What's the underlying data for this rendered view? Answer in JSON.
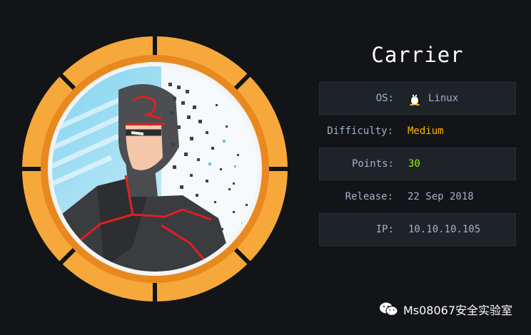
{
  "machine": {
    "name": "Carrier"
  },
  "info": {
    "os_label": "OS:",
    "os_value": "Linux",
    "os_icon": "linux-tux-icon",
    "difficulty_label": "Difficulty:",
    "difficulty_value": "Medium",
    "points_label": "Points:",
    "points_value": "30",
    "release_label": "Release:",
    "release_value": "22 Sep 2018",
    "ip_label": "IP:",
    "ip_value": "10.10.10.105"
  },
  "watermark": {
    "text": "Ms08067安全实验室",
    "icon": "wechat-icon"
  },
  "colors": {
    "background": "#121417",
    "ring": "#f7a83a",
    "ring_dark": "#1a1d22",
    "difficulty": "#ffaf00",
    "points": "#9fef00",
    "label": "#a4b1cd"
  }
}
